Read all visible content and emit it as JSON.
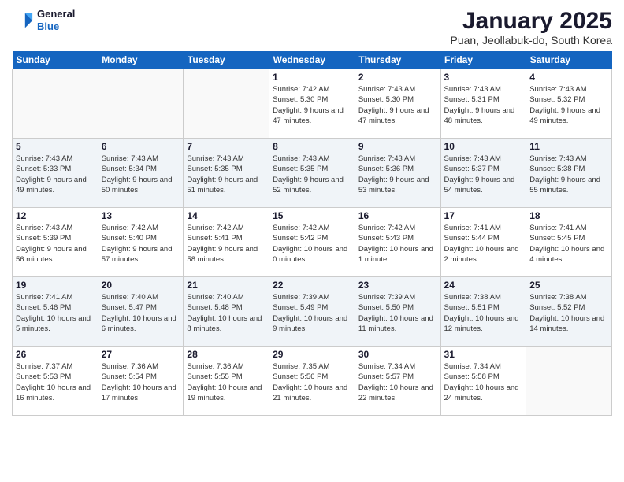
{
  "logo": {
    "line1": "General",
    "line2": "Blue"
  },
  "title": "January 2025",
  "subtitle": "Puan, Jeollabuk-do, South Korea",
  "headers": [
    "Sunday",
    "Monday",
    "Tuesday",
    "Wednesday",
    "Thursday",
    "Friday",
    "Saturday"
  ],
  "weeks": [
    [
      {
        "day": "",
        "text": ""
      },
      {
        "day": "",
        "text": ""
      },
      {
        "day": "",
        "text": ""
      },
      {
        "day": "1",
        "text": "Sunrise: 7:42 AM\nSunset: 5:30 PM\nDaylight: 9 hours and 47 minutes."
      },
      {
        "day": "2",
        "text": "Sunrise: 7:43 AM\nSunset: 5:30 PM\nDaylight: 9 hours and 47 minutes."
      },
      {
        "day": "3",
        "text": "Sunrise: 7:43 AM\nSunset: 5:31 PM\nDaylight: 9 hours and 48 minutes."
      },
      {
        "day": "4",
        "text": "Sunrise: 7:43 AM\nSunset: 5:32 PM\nDaylight: 9 hours and 49 minutes."
      }
    ],
    [
      {
        "day": "5",
        "text": "Sunrise: 7:43 AM\nSunset: 5:33 PM\nDaylight: 9 hours and 49 minutes."
      },
      {
        "day": "6",
        "text": "Sunrise: 7:43 AM\nSunset: 5:34 PM\nDaylight: 9 hours and 50 minutes."
      },
      {
        "day": "7",
        "text": "Sunrise: 7:43 AM\nSunset: 5:35 PM\nDaylight: 9 hours and 51 minutes."
      },
      {
        "day": "8",
        "text": "Sunrise: 7:43 AM\nSunset: 5:35 PM\nDaylight: 9 hours and 52 minutes."
      },
      {
        "day": "9",
        "text": "Sunrise: 7:43 AM\nSunset: 5:36 PM\nDaylight: 9 hours and 53 minutes."
      },
      {
        "day": "10",
        "text": "Sunrise: 7:43 AM\nSunset: 5:37 PM\nDaylight: 9 hours and 54 minutes."
      },
      {
        "day": "11",
        "text": "Sunrise: 7:43 AM\nSunset: 5:38 PM\nDaylight: 9 hours and 55 minutes."
      }
    ],
    [
      {
        "day": "12",
        "text": "Sunrise: 7:43 AM\nSunset: 5:39 PM\nDaylight: 9 hours and 56 minutes."
      },
      {
        "day": "13",
        "text": "Sunrise: 7:42 AM\nSunset: 5:40 PM\nDaylight: 9 hours and 57 minutes."
      },
      {
        "day": "14",
        "text": "Sunrise: 7:42 AM\nSunset: 5:41 PM\nDaylight: 9 hours and 58 minutes."
      },
      {
        "day": "15",
        "text": "Sunrise: 7:42 AM\nSunset: 5:42 PM\nDaylight: 10 hours and 0 minutes."
      },
      {
        "day": "16",
        "text": "Sunrise: 7:42 AM\nSunset: 5:43 PM\nDaylight: 10 hours and 1 minute."
      },
      {
        "day": "17",
        "text": "Sunrise: 7:41 AM\nSunset: 5:44 PM\nDaylight: 10 hours and 2 minutes."
      },
      {
        "day": "18",
        "text": "Sunrise: 7:41 AM\nSunset: 5:45 PM\nDaylight: 10 hours and 4 minutes."
      }
    ],
    [
      {
        "day": "19",
        "text": "Sunrise: 7:41 AM\nSunset: 5:46 PM\nDaylight: 10 hours and 5 minutes."
      },
      {
        "day": "20",
        "text": "Sunrise: 7:40 AM\nSunset: 5:47 PM\nDaylight: 10 hours and 6 minutes."
      },
      {
        "day": "21",
        "text": "Sunrise: 7:40 AM\nSunset: 5:48 PM\nDaylight: 10 hours and 8 minutes."
      },
      {
        "day": "22",
        "text": "Sunrise: 7:39 AM\nSunset: 5:49 PM\nDaylight: 10 hours and 9 minutes."
      },
      {
        "day": "23",
        "text": "Sunrise: 7:39 AM\nSunset: 5:50 PM\nDaylight: 10 hours and 11 minutes."
      },
      {
        "day": "24",
        "text": "Sunrise: 7:38 AM\nSunset: 5:51 PM\nDaylight: 10 hours and 12 minutes."
      },
      {
        "day": "25",
        "text": "Sunrise: 7:38 AM\nSunset: 5:52 PM\nDaylight: 10 hours and 14 minutes."
      }
    ],
    [
      {
        "day": "26",
        "text": "Sunrise: 7:37 AM\nSunset: 5:53 PM\nDaylight: 10 hours and 16 minutes."
      },
      {
        "day": "27",
        "text": "Sunrise: 7:36 AM\nSunset: 5:54 PM\nDaylight: 10 hours and 17 minutes."
      },
      {
        "day": "28",
        "text": "Sunrise: 7:36 AM\nSunset: 5:55 PM\nDaylight: 10 hours and 19 minutes."
      },
      {
        "day": "29",
        "text": "Sunrise: 7:35 AM\nSunset: 5:56 PM\nDaylight: 10 hours and 21 minutes."
      },
      {
        "day": "30",
        "text": "Sunrise: 7:34 AM\nSunset: 5:57 PM\nDaylight: 10 hours and 22 minutes."
      },
      {
        "day": "31",
        "text": "Sunrise: 7:34 AM\nSunset: 5:58 PM\nDaylight: 10 hours and 24 minutes."
      },
      {
        "day": "",
        "text": ""
      }
    ]
  ]
}
